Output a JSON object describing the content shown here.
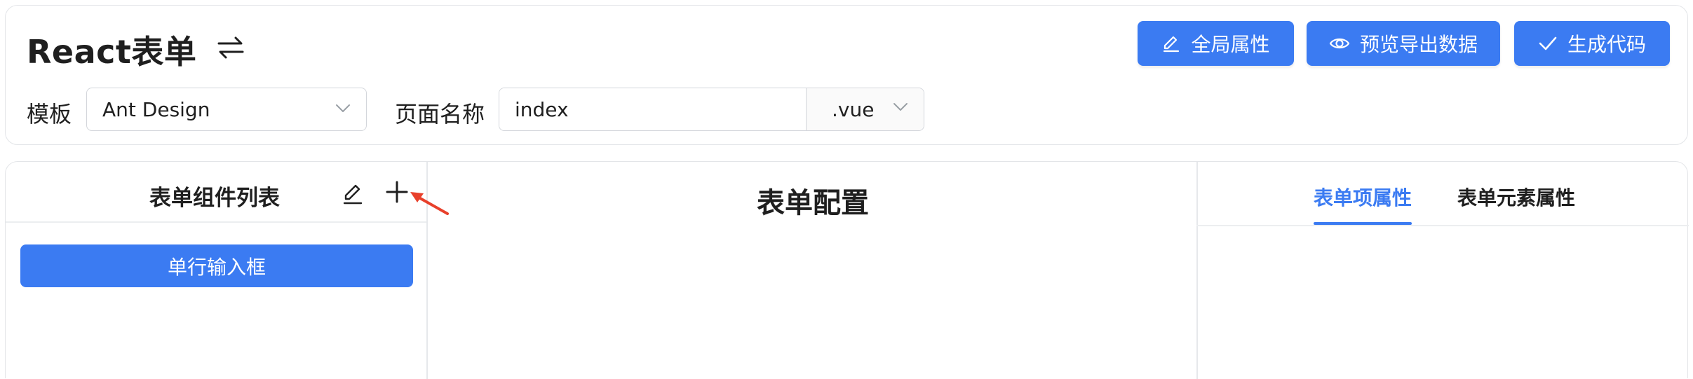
{
  "header": {
    "title": "React表单",
    "actions": {
      "global_props": "全局属性",
      "preview_export": "预览导出数据",
      "generate_code": "生成代码"
    },
    "template": {
      "label": "模板",
      "value": "Ant Design"
    },
    "page_name": {
      "label": "页面名称",
      "value": "index",
      "extension": ".vue"
    }
  },
  "left_panel": {
    "title": "表单组件列表",
    "items": [
      {
        "label": "单行输入框"
      }
    ]
  },
  "center_panel": {
    "title": "表单配置"
  },
  "right_panel": {
    "tabs": [
      {
        "label": "表单项属性",
        "active": true
      },
      {
        "label": "表单元素属性",
        "active": false
      }
    ]
  },
  "colors": {
    "primary": "#3b7bf2",
    "annotation_arrow": "#e8402b",
    "border": "#e3e5e8"
  }
}
